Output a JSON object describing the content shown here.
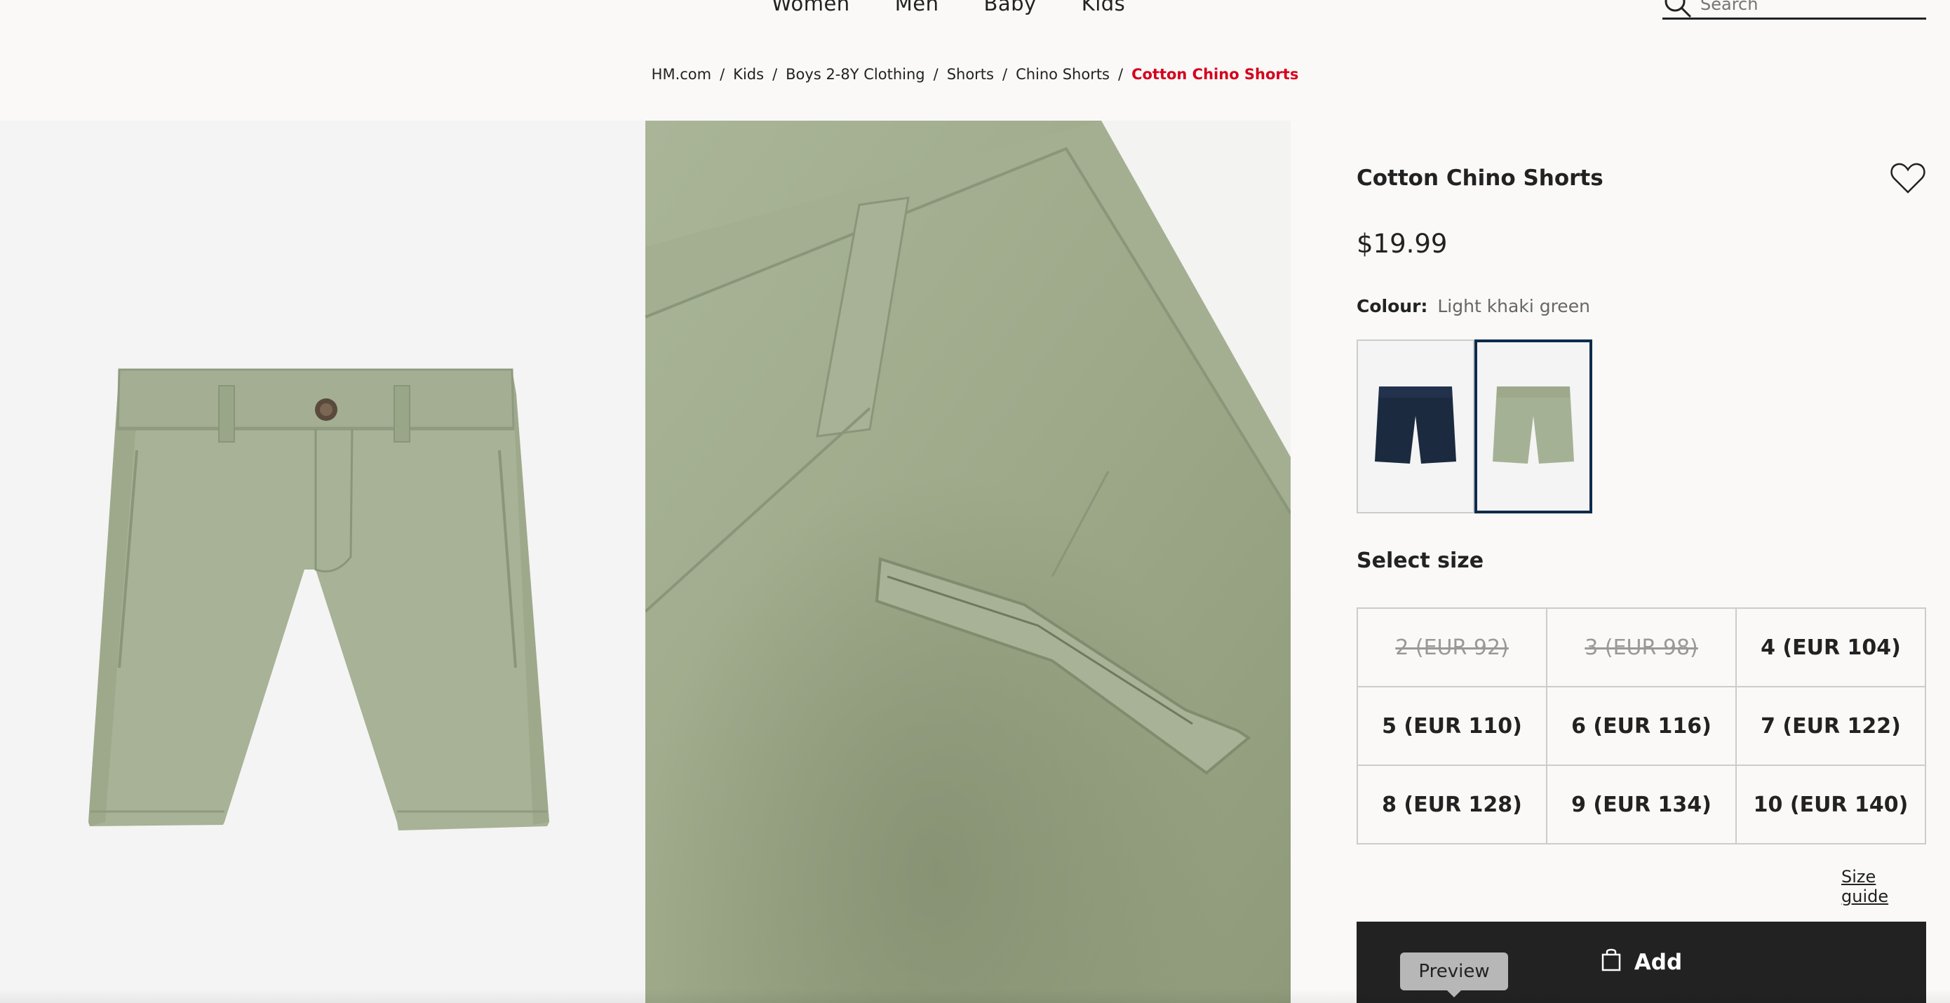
{
  "nav": {
    "links": [
      "Women",
      "Men",
      "Baby",
      "Kids"
    ],
    "search_placeholder": "Search"
  },
  "breadcrumb": [
    "HM.com",
    "Kids",
    "Boys 2-8Y Clothing",
    "Shorts",
    "Chino Shorts",
    "Cotton Chino Shorts"
  ],
  "product": {
    "title": "Cotton Chino Shorts",
    "price": "$19.99",
    "colour_label": "Colour:",
    "colour_value": "Light khaki green",
    "swatches": [
      {
        "name": "Dark navy",
        "color": "#1c2a40",
        "selected": false
      },
      {
        "name": "Light khaki green",
        "color": "#a5b195",
        "selected": true
      }
    ],
    "select_size_label": "Select size",
    "sizes": [
      {
        "label": "2 (EUR 92)",
        "available": false
      },
      {
        "label": "3 (EUR 98)",
        "available": false
      },
      {
        "label": "4 (EUR 104)",
        "available": true
      },
      {
        "label": "5 (EUR 110)",
        "available": true
      },
      {
        "label": "6 (EUR 116)",
        "available": true
      },
      {
        "label": "7 (EUR 122)",
        "available": true
      },
      {
        "label": "8 (EUR 128)",
        "available": true
      },
      {
        "label": "9 (EUR 134)",
        "available": true
      },
      {
        "label": "10 (EUR 140)",
        "available": true
      }
    ],
    "size_guide_label": "Size guide",
    "add_label": "Add",
    "preview_label": "Preview"
  },
  "colors": {
    "accent_red": "#d6001c",
    "product_green": "#a5b195",
    "dark_button": "#222222",
    "selected_border": "#0e2b4a"
  }
}
